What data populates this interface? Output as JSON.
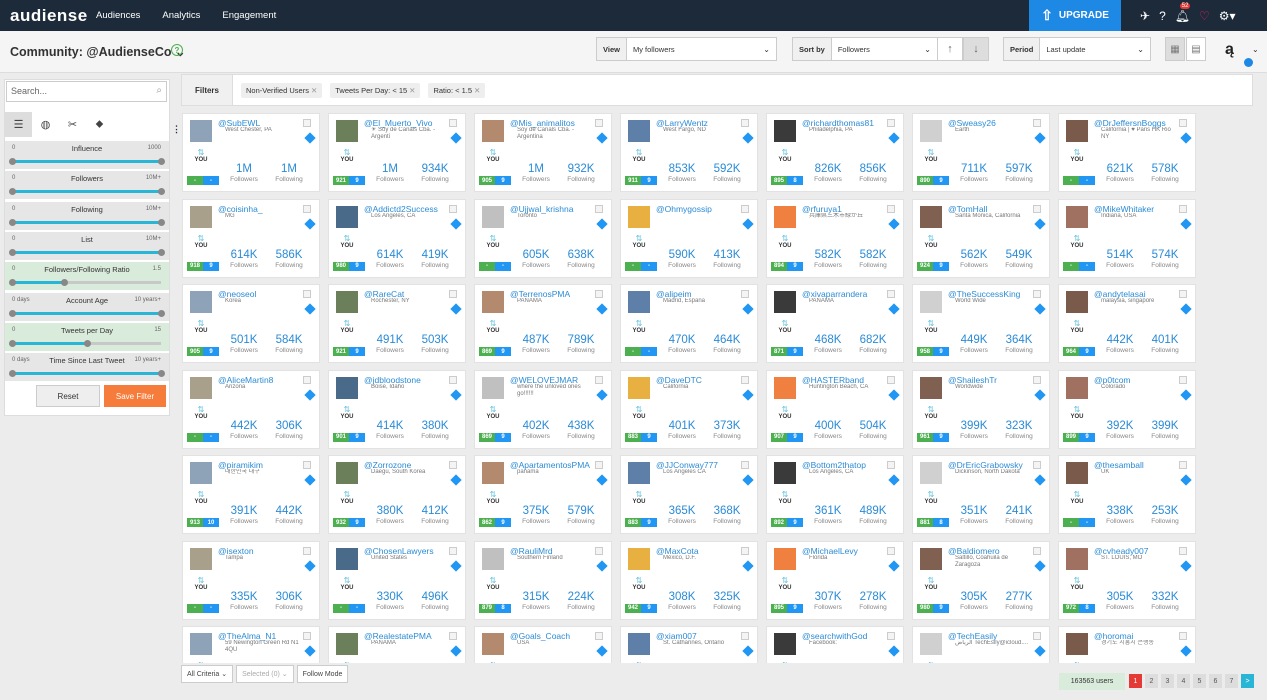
{
  "nav": {
    "logo": "audiense",
    "links": [
      "Audiences",
      "Analytics",
      "Engagement"
    ],
    "upgrade": "UPGRADE",
    "notif_count": "52"
  },
  "subheader": {
    "community": "Community: @AudienseCo",
    "view": {
      "label": "View",
      "value": "My followers"
    },
    "sort": {
      "label": "Sort by",
      "value": "Followers"
    },
    "period": {
      "label": "Period",
      "value": "Last update"
    }
  },
  "sidebar": {
    "search_placeholder": "Search...",
    "sliders": [
      {
        "title": "Influence",
        "min": "0",
        "max": "1000",
        "green": false,
        "lo": 0.0,
        "hi": 1.0
      },
      {
        "title": "Followers",
        "min": "0",
        "max": "10M+",
        "green": false,
        "lo": 0.0,
        "hi": 1.0
      },
      {
        "title": "Following",
        "min": "0",
        "max": "10M+",
        "green": false,
        "lo": 0.0,
        "hi": 1.0
      },
      {
        "title": "List",
        "min": "0",
        "max": "10M+",
        "green": false,
        "lo": 0.0,
        "hi": 1.0
      },
      {
        "title": "Followers/Following Ratio",
        "min": "0",
        "max": "1.5",
        "green": true,
        "lo": 0.0,
        "hi": 0.35
      },
      {
        "title": "Account Age",
        "min": "0 days",
        "max": "10 years+",
        "green": false,
        "lo": 0.0,
        "hi": 1.0
      },
      {
        "title": "Tweets per Day",
        "min": "0",
        "max": "15",
        "green": true,
        "lo": 0.0,
        "hi": 0.5
      },
      {
        "title": "Time Since Last Tweet",
        "min": "0 days",
        "max": "10 years+",
        "green": false,
        "lo": 0.0,
        "hi": 1.0
      }
    ],
    "reset": "Reset",
    "save": "Save Filter"
  },
  "filters": {
    "title": "Filters",
    "chips": [
      "Non-Verified Users",
      "Tweets Per Day: < 15",
      "Ratio: < 1.5"
    ]
  },
  "cards": [
    {
      "h": "@SubEWL",
      "loc": "West Chester, PA",
      "f": "1M",
      "g": "1M",
      "p1": "-",
      "p2": "-"
    },
    {
      "h": "@El_Muerto_Vivo",
      "loc": "☀ Soy de Canals Cba. - Argenti",
      "f": "1M",
      "g": "934K",
      "p1": "921",
      "p2": "9"
    },
    {
      "h": "@Mis_animalitos",
      "loc": "Soy de Canals Cba. - Argentina",
      "f": "1M",
      "g": "932K",
      "p1": "905",
      "p2": "9"
    },
    {
      "h": "@LarryWentz",
      "loc": "West Fargo, ND",
      "f": "853K",
      "g": "592K",
      "p1": "911",
      "p2": "9"
    },
    {
      "h": "@richardthomas81",
      "loc": "Philadelphia, PA",
      "f": "826K",
      "g": "856K",
      "p1": "895",
      "p2": "8"
    },
    {
      "h": "@Sweasy26",
      "loc": "Earth",
      "f": "711K",
      "g": "597K",
      "p1": "890",
      "p2": "9"
    },
    {
      "h": "@DrJeffersnBoggs",
      "loc": "California | ♥ Paris HK Rio NY",
      "f": "621K",
      "g": "578K",
      "p1": "-",
      "p2": "-"
    },
    {
      "h": "@coisinha_",
      "loc": "MG",
      "f": "614K",
      "g": "586K",
      "p1": "918",
      "p2": "9"
    },
    {
      "h": "@Addictd2Success",
      "loc": "Los Angeles, CA",
      "f": "614K",
      "g": "419K",
      "p1": "980",
      "p2": "9"
    },
    {
      "h": "@Ujjwal_krishna",
      "loc": "Toronto",
      "f": "605K",
      "g": "638K",
      "p1": "-",
      "p2": "-"
    },
    {
      "h": "@Ohmygossip",
      "loc": "",
      "f": "590K",
      "g": "413K",
      "p1": "-",
      "p2": "-"
    },
    {
      "h": "@rfuruya1",
      "loc": "兵庫県三木市緑が丘",
      "f": "582K",
      "g": "582K",
      "p1": "894",
      "p2": "9"
    },
    {
      "h": "@TomHall",
      "loc": "Santa Monica, California",
      "f": "562K",
      "g": "549K",
      "p1": "924",
      "p2": "9"
    },
    {
      "h": "@MikeWhitaker",
      "loc": "Indiana, USA",
      "f": "514K",
      "g": "574K",
      "p1": "-",
      "p2": "-"
    },
    {
      "h": "@neoseol",
      "loc": "Korea",
      "f": "501K",
      "g": "584K",
      "p1": "905",
      "p2": "9"
    },
    {
      "h": "@RareCat",
      "loc": "Rochester, NY",
      "f": "491K",
      "g": "503K",
      "p1": "921",
      "p2": "9"
    },
    {
      "h": "@TerrenosPMA",
      "loc": "PANAMA",
      "f": "487K",
      "g": "789K",
      "p1": "869",
      "p2": "9"
    },
    {
      "h": "@alipeim",
      "loc": "Madrid, España",
      "f": "470K",
      "g": "464K",
      "p1": "-",
      "p2": "-"
    },
    {
      "h": "@xivaparrandera",
      "loc": "PANAMA",
      "f": "468K",
      "g": "682K",
      "p1": "871",
      "p2": "9"
    },
    {
      "h": "@TheSuccessKing",
      "loc": "World Wide",
      "f": "449K",
      "g": "364K",
      "p1": "958",
      "p2": "9"
    },
    {
      "h": "@andytelasai",
      "loc": "malaysia, singapore",
      "f": "442K",
      "g": "401K",
      "p1": "964",
      "p2": "9"
    },
    {
      "h": "@AliceMartin8",
      "loc": "Arizona",
      "f": "442K",
      "g": "306K",
      "p1": "-",
      "p2": "-"
    },
    {
      "h": "@jdbloodstone",
      "loc": "Boise, Idaho",
      "f": "414K",
      "g": "380K",
      "p1": "901",
      "p2": "9"
    },
    {
      "h": "@WELOVEJMAR",
      "loc": "where the unloved ones go!!!!!!",
      "f": "402K",
      "g": "438K",
      "p1": "869",
      "p2": "9"
    },
    {
      "h": "@DaveDTC",
      "loc": "California",
      "f": "401K",
      "g": "373K",
      "p1": "883",
      "p2": "9"
    },
    {
      "h": "@HASTERband",
      "loc": "Huntington Beach, CA",
      "f": "400K",
      "g": "504K",
      "p1": "907",
      "p2": "9"
    },
    {
      "h": "@ShaileshTr",
      "loc": "Worldwide",
      "f": "399K",
      "g": "323K",
      "p1": "961",
      "p2": "9"
    },
    {
      "h": "@p0tcom",
      "loc": "Colorado",
      "f": "392K",
      "g": "399K",
      "p1": "899",
      "p2": "9"
    },
    {
      "h": "@piramikim",
      "loc": "대한민국 대구",
      "f": "391K",
      "g": "442K",
      "p1": "913",
      "p2": "10"
    },
    {
      "h": "@Zorrozone",
      "loc": "Daegu, South Korea",
      "f": "380K",
      "g": "412K",
      "p1": "932",
      "p2": "9"
    },
    {
      "h": "@ApartamentosPMA",
      "loc": "panama",
      "f": "375K",
      "g": "579K",
      "p1": "862",
      "p2": "9"
    },
    {
      "h": "@JJConway777",
      "loc": "Los Angeles CA",
      "f": "365K",
      "g": "368K",
      "p1": "883",
      "p2": "9"
    },
    {
      "h": "@Bottom2thatop",
      "loc": "Los Angeles, CA",
      "f": "361K",
      "g": "489K",
      "p1": "892",
      "p2": "9"
    },
    {
      "h": "@DrEricGrabowsky",
      "loc": "Dickinson, North Dakota",
      "f": "351K",
      "g": "241K",
      "p1": "881",
      "p2": "8"
    },
    {
      "h": "@thesamball",
      "loc": "UK",
      "f": "338K",
      "g": "253K",
      "p1": "-",
      "p2": "-"
    },
    {
      "h": "@isexton",
      "loc": "Tampa",
      "f": "335K",
      "g": "306K",
      "p1": "-",
      "p2": "-"
    },
    {
      "h": "@ChosenLawyers",
      "loc": "United States",
      "f": "330K",
      "g": "496K",
      "p1": "-",
      "p2": "-"
    },
    {
      "h": "@RauliMrd",
      "loc": "Southern Finland",
      "f": "315K",
      "g": "224K",
      "p1": "879",
      "p2": "8"
    },
    {
      "h": "@MaxCota",
      "loc": "México, D.F.",
      "f": "308K",
      "g": "325K",
      "p1": "942",
      "p2": "9"
    },
    {
      "h": "@MichaelLevy",
      "loc": "Florida",
      "f": "307K",
      "g": "278K",
      "p1": "895",
      "p2": "9"
    },
    {
      "h": "@Baldiomero",
      "loc": "Saltillo, Coahuila de Zaragoza",
      "f": "305K",
      "g": "277K",
      "p1": "980",
      "p2": "9"
    },
    {
      "h": "@cvheady007",
      "loc": "ST. LOUIS, MO",
      "f": "305K",
      "g": "332K",
      "p1": "972",
      "p2": "8"
    },
    {
      "h": "@TheAlma_N1",
      "loc": "59 Newington Green Rd N1 4QU",
      "f": "",
      "g": "",
      "p1": "",
      "p2": ""
    },
    {
      "h": "@RealestatePMA",
      "loc": "PANAMA",
      "f": "",
      "g": "",
      "p1": "",
      "p2": ""
    },
    {
      "h": "@Goals_Coach",
      "loc": "USA",
      "f": "",
      "g": "",
      "p1": "",
      "p2": ""
    },
    {
      "h": "@xiam007",
      "loc": "St. Catharines, Ontario",
      "f": "",
      "g": "",
      "p1": "",
      "p2": ""
    },
    {
      "h": "@searchwithGod",
      "loc": "Facebook:",
      "f": "",
      "g": "",
      "p1": "",
      "p2": ""
    },
    {
      "h": "@TechEasily",
      "loc": "الرياض TechEsily@icloud....",
      "f": "",
      "g": "",
      "p1": "",
      "p2": ""
    },
    {
      "h": "@horomai",
      "loc": "경기도 시흥시 은행동",
      "f": "",
      "g": "",
      "p1": "",
      "p2": ""
    }
  ],
  "labels": {
    "followers": "Followers",
    "following": "Following",
    "you": "YOU"
  },
  "bottom": {
    "criteria": "All Criteria",
    "selected": "Selected (0)",
    "follow_mode": "Follow Mode",
    "users": "163563 users",
    "pages": [
      "1",
      "2",
      "3",
      "4",
      "5",
      "6",
      "7"
    ],
    "next": ">"
  }
}
